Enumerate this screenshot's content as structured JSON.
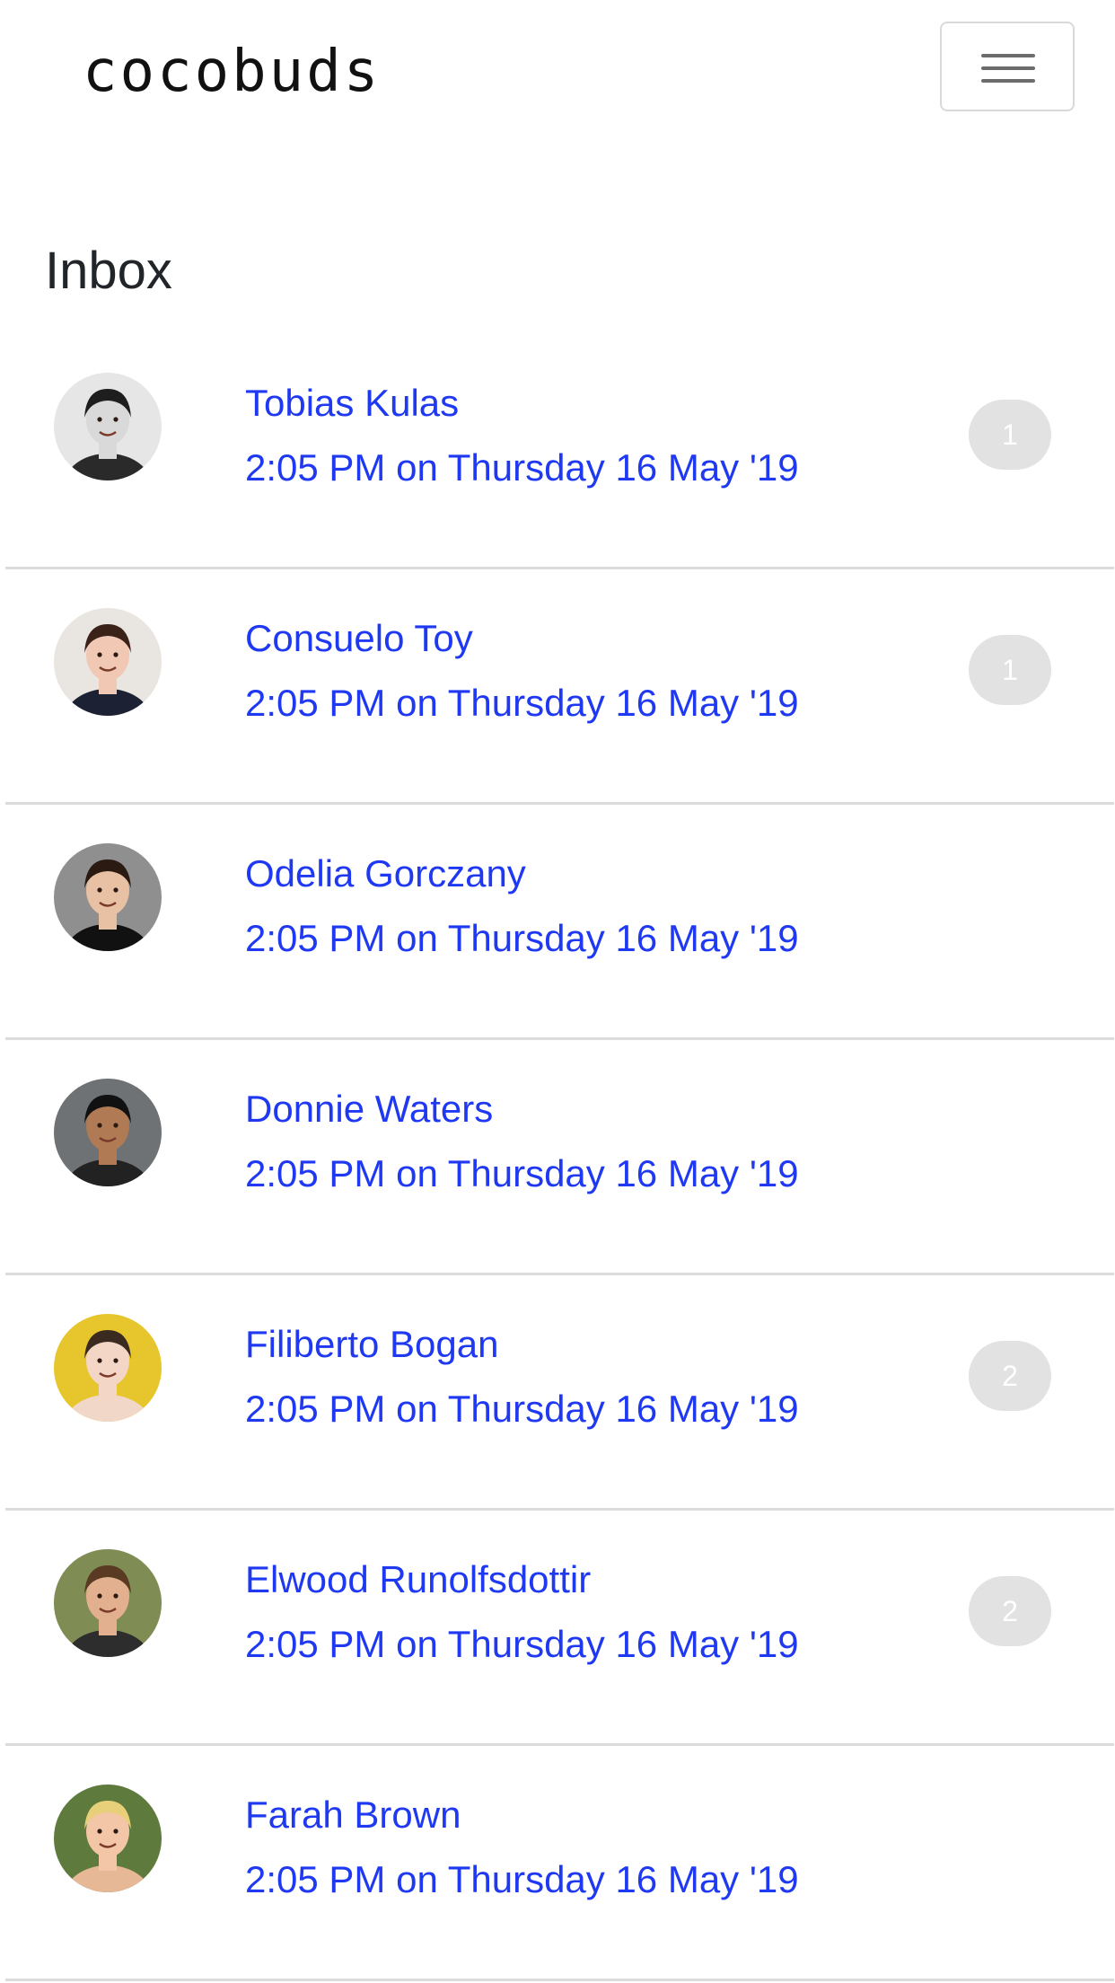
{
  "navbar": {
    "brand": "cocobuds",
    "menu_icon": "hamburger-menu-icon"
  },
  "page": {
    "title": "Inbox"
  },
  "inbox": [
    {
      "name": "Tobias Kulas",
      "time": "2:05 PM on Thursday 16 May '19",
      "unread": "1",
      "avatar": {
        "bg": "#e6e6e6",
        "skin": "#d9d9d9",
        "hair": "#1e1e1e",
        "shirt": "#2a2a2a"
      }
    },
    {
      "name": "Consuelo Toy",
      "time": "2:05 PM on Thursday 16 May '19",
      "unread": "1",
      "avatar": {
        "bg": "#e9e5e0",
        "skin": "#f0c8b4",
        "hair": "#3a2219",
        "shirt": "#1c2233"
      }
    },
    {
      "name": "Odelia Gorczany",
      "time": "2:05 PM on Thursday 16 May '19",
      "unread": "",
      "avatar": {
        "bg": "#8f8f8f",
        "skin": "#e8c0a4",
        "hair": "#2b1a12",
        "shirt": "#111111"
      }
    },
    {
      "name": "Donnie Waters",
      "time": "2:05 PM on Thursday 16 May '19",
      "unread": "",
      "avatar": {
        "bg": "#6f7274",
        "skin": "#b07a55",
        "hair": "#111111",
        "shirt": "#222222"
      }
    },
    {
      "name": "Filiberto Bogan",
      "time": "2:05 PM on Thursday 16 May '19",
      "unread": "2",
      "avatar": {
        "bg": "#e7c62d",
        "skin": "#f4d6c6",
        "hair": "#3a2a20",
        "shirt": "#f1d7c8"
      }
    },
    {
      "name": "Elwood Runolfsdottir",
      "time": "2:05 PM on Thursday 16 May '19",
      "unread": "2",
      "avatar": {
        "bg": "#7f8d54",
        "skin": "#e2b08e",
        "hair": "#5a3a22",
        "shirt": "#2d2d2d"
      }
    },
    {
      "name": "Farah Brown",
      "time": "2:05 PM on Thursday 16 May '19",
      "unread": "",
      "avatar": {
        "bg": "#5f7a3d",
        "skin": "#f2c6a6",
        "hair": "#e8cf7a",
        "shirt": "#e7b896"
      }
    }
  ],
  "colors": {
    "link": "#1f39f2",
    "badge_bg": "#e2e2e2",
    "divider": "#dcdcdc"
  }
}
